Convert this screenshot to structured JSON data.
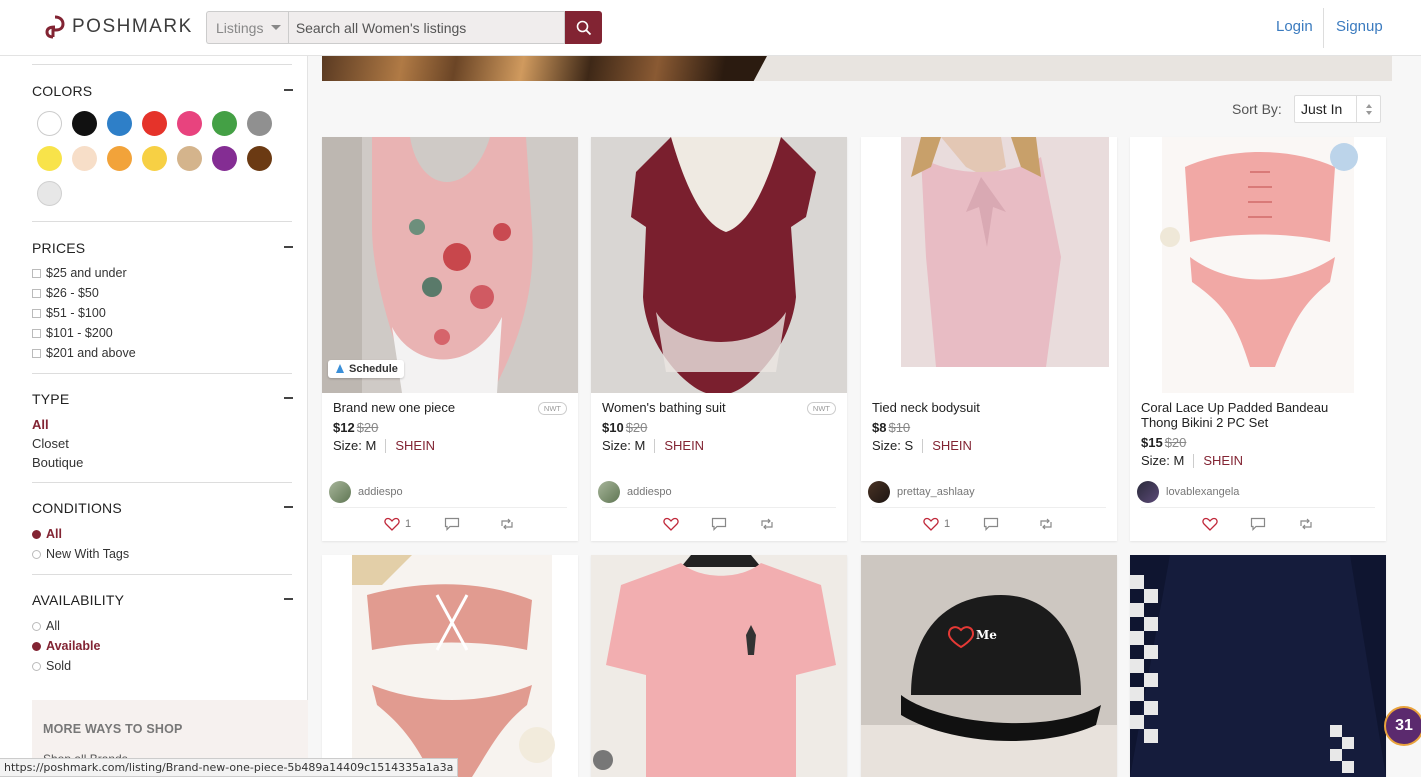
{
  "header": {
    "logo_text": "POSHMARK",
    "search_category": "Listings",
    "search_placeholder": "Search all Women's listings",
    "login_label": "Login",
    "signup_label": "Signup"
  },
  "sidebar": {
    "colors_title": "COLORS",
    "colors": [
      "#ffffff",
      "#111111",
      "#2e7fc8",
      "#e5332a",
      "#e8437e",
      "#44a045",
      "#909090",
      "#f8e34a",
      "#f7dec8",
      "#f2a33a",
      "#f7d044",
      "#d4b48c",
      "#842d93",
      "#6b3a13",
      "#e7e7e7"
    ],
    "prices_title": "PRICES",
    "prices": [
      "$25 and under",
      "$26 - $50",
      "$51 - $100",
      "$101 - $200",
      "$201 and above"
    ],
    "type_title": "TYPE",
    "types": [
      "All",
      "Closet",
      "Boutique"
    ],
    "conditions_title": "CONDITIONS",
    "conditions": [
      "All",
      "New With Tags"
    ],
    "availability_title": "AVAILABILITY",
    "availability": [
      "All",
      "Available",
      "Sold"
    ],
    "more_ways_title": "MORE WAYS TO SHOP",
    "more_ways_link": "Shop all Brands"
  },
  "main": {
    "sort_label": "Sort By:",
    "sort_value": "Just In",
    "listings": [
      {
        "title": "Brand new one piece",
        "nwt": "NWT",
        "price": "$12",
        "orig": "$20",
        "size_label": "Size: M",
        "brand": "SHEIN",
        "seller": "addiespo",
        "likes": "1",
        "schedule": "Schedule"
      },
      {
        "title": "Women's bathing suit",
        "nwt": "NWT",
        "price": "$10",
        "orig": "$20",
        "size_label": "Size: M",
        "brand": "SHEIN",
        "seller": "addiespo",
        "likes": ""
      },
      {
        "title": "Tied neck bodysuit",
        "price": "$8",
        "orig": "$10",
        "size_label": "Size: S",
        "brand": "SHEIN",
        "seller": "prettay_ashlaay",
        "likes": "1"
      },
      {
        "title": "Coral Lace Up Padded Bandeau Thong Bikini 2 PC Set",
        "price": "$15",
        "orig": "$20",
        "size_label": "Size: M",
        "brand": "SHEIN",
        "seller": "lovablexangela",
        "likes": ""
      }
    ]
  },
  "status_url": "https://poshmark.com/listing/Brand-new-one-piece-5b489a14409c1514335a1a3a",
  "chat_badge": "31"
}
